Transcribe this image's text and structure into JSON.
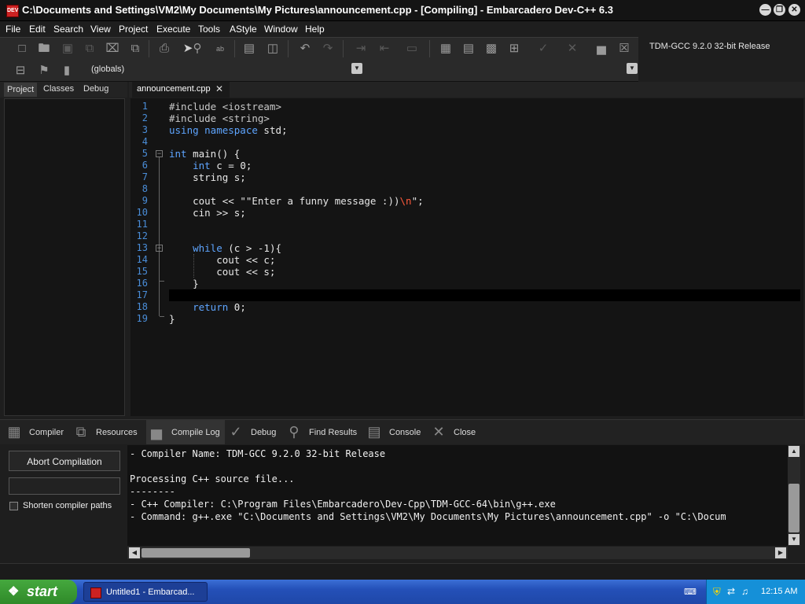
{
  "window": {
    "title": "C:\\Documents and Settings\\VM2\\My Documents\\My Pictures\\announcement.cpp - [Compiling] - Embarcadero Dev-C++ 6.3",
    "icon_text": "DEV",
    "controls": {
      "minimize": "—",
      "restore": "❐",
      "close": "✕"
    }
  },
  "menu": {
    "items": [
      "File",
      "Edit",
      "Search",
      "View",
      "Project",
      "Execute",
      "Tools",
      "AStyle",
      "Window",
      "Help"
    ]
  },
  "toolbar": {
    "compiler_select": "TDM-GCC 9.2.0 32-bit Release",
    "scope_select": "(globals)",
    "icons": [
      "new-file-icon",
      "open-icon",
      "save-icon",
      "save-all-icon",
      "close-file-icon",
      "close-all-icon",
      "print-icon",
      "find-icon",
      "replace-icon",
      "goto-line-icon",
      "toggle-bookmark-icon",
      "undo-icon",
      "redo-icon",
      "indent-icon",
      "unindent-icon",
      "comment-icon",
      "compile-icon",
      "run-icon",
      "compile-run-icon",
      "rebuild-icon",
      "syntax-check-icon",
      "stop-icon",
      "profile-icon",
      "delete-profile-icon"
    ]
  },
  "left_panel": {
    "tabs": [
      "Project",
      "Classes",
      "Debug"
    ],
    "active_tab": "Project"
  },
  "editor": {
    "tab_label": "announcement.cpp",
    "current_line": 17,
    "line_numbers": [
      "1",
      "2",
      "3",
      "4",
      "5",
      "6",
      "7",
      "8",
      "9",
      "10",
      "11",
      "12",
      "13",
      "14",
      "15",
      "16",
      "17",
      "18",
      "19"
    ],
    "lines": [
      {
        "n": 1,
        "parts": [
          [
            "pp",
            "#include <iostream>"
          ]
        ]
      },
      {
        "n": 2,
        "parts": [
          [
            "pp",
            "#include <string>"
          ]
        ]
      },
      {
        "n": 3,
        "parts": [
          [
            "kw",
            "using namespace"
          ],
          [
            "txt",
            " std;"
          ]
        ]
      },
      {
        "n": 4,
        "parts": []
      },
      {
        "n": 5,
        "parts": [
          [
            "kw",
            "int"
          ],
          [
            "txt",
            " main() {"
          ]
        ]
      },
      {
        "n": 6,
        "parts": [
          [
            "txt",
            "    "
          ],
          [
            "kw",
            "int"
          ],
          [
            "txt",
            " c = 0;"
          ]
        ]
      },
      {
        "n": 7,
        "parts": [
          [
            "txt",
            "    string s;"
          ]
        ]
      },
      {
        "n": 8,
        "parts": []
      },
      {
        "n": 9,
        "parts": [
          [
            "txt",
            "    cout << "
          ],
          [
            "str",
            "\"\"Enter a funny message :))"
          ],
          [
            "esc",
            "\\n"
          ],
          [
            "str",
            "\";"
          ]
        ]
      },
      {
        "n": 10,
        "parts": [
          [
            "txt",
            "    cin >> s;"
          ]
        ]
      },
      {
        "n": 11,
        "parts": []
      },
      {
        "n": 12,
        "parts": []
      },
      {
        "n": 13,
        "parts": [
          [
            "txt",
            "    "
          ],
          [
            "kw",
            "while"
          ],
          [
            "txt",
            " (c > -1){"
          ]
        ]
      },
      {
        "n": 14,
        "parts": [
          [
            "txt",
            "        cout << c;"
          ]
        ]
      },
      {
        "n": 15,
        "parts": [
          [
            "txt",
            "        cout << s;"
          ]
        ]
      },
      {
        "n": 16,
        "parts": [
          [
            "txt",
            "    }"
          ]
        ]
      },
      {
        "n": 17,
        "parts": []
      },
      {
        "n": 18,
        "parts": [
          [
            "txt",
            "    "
          ],
          [
            "kw",
            "return"
          ],
          [
            "txt",
            " 0;"
          ]
        ]
      },
      {
        "n": 19,
        "parts": [
          [
            "txt",
            "}"
          ]
        ]
      }
    ]
  },
  "bottom_tabs": [
    {
      "label": "Compiler",
      "icon": "compiler-grid-icon"
    },
    {
      "label": "Resources",
      "icon": "resources-icon"
    },
    {
      "label": "Compile Log",
      "icon": "compile-log-icon",
      "active": true
    },
    {
      "label": "Debug",
      "icon": "debug-check-icon"
    },
    {
      "label": "Find Results",
      "icon": "find-results-icon"
    },
    {
      "label": "Console",
      "icon": "console-icon"
    },
    {
      "label": "Close",
      "icon": "close-x-icon"
    }
  ],
  "compile_panel": {
    "abort_label": "Abort Compilation",
    "shorten_label": "Shorten compiler paths",
    "shorten_checked": false
  },
  "compile_log": [
    "- Compiler Name: TDM-GCC 9.2.0 32-bit Release",
    "",
    "Processing C++ source file...",
    "--------",
    "- C++ Compiler: C:\\Program Files\\Embarcadero\\Dev-Cpp\\TDM-GCC-64\\bin\\g++.exe",
    "- Command: g++.exe \"C:\\Documents and Settings\\VM2\\My Documents\\My Pictures\\announcement.cpp\" -o \"C:\\Docum"
  ],
  "taskbar": {
    "start_label": "start",
    "task_label": "Untitled1 - Embarcad...",
    "clock": "12:15 AM"
  }
}
